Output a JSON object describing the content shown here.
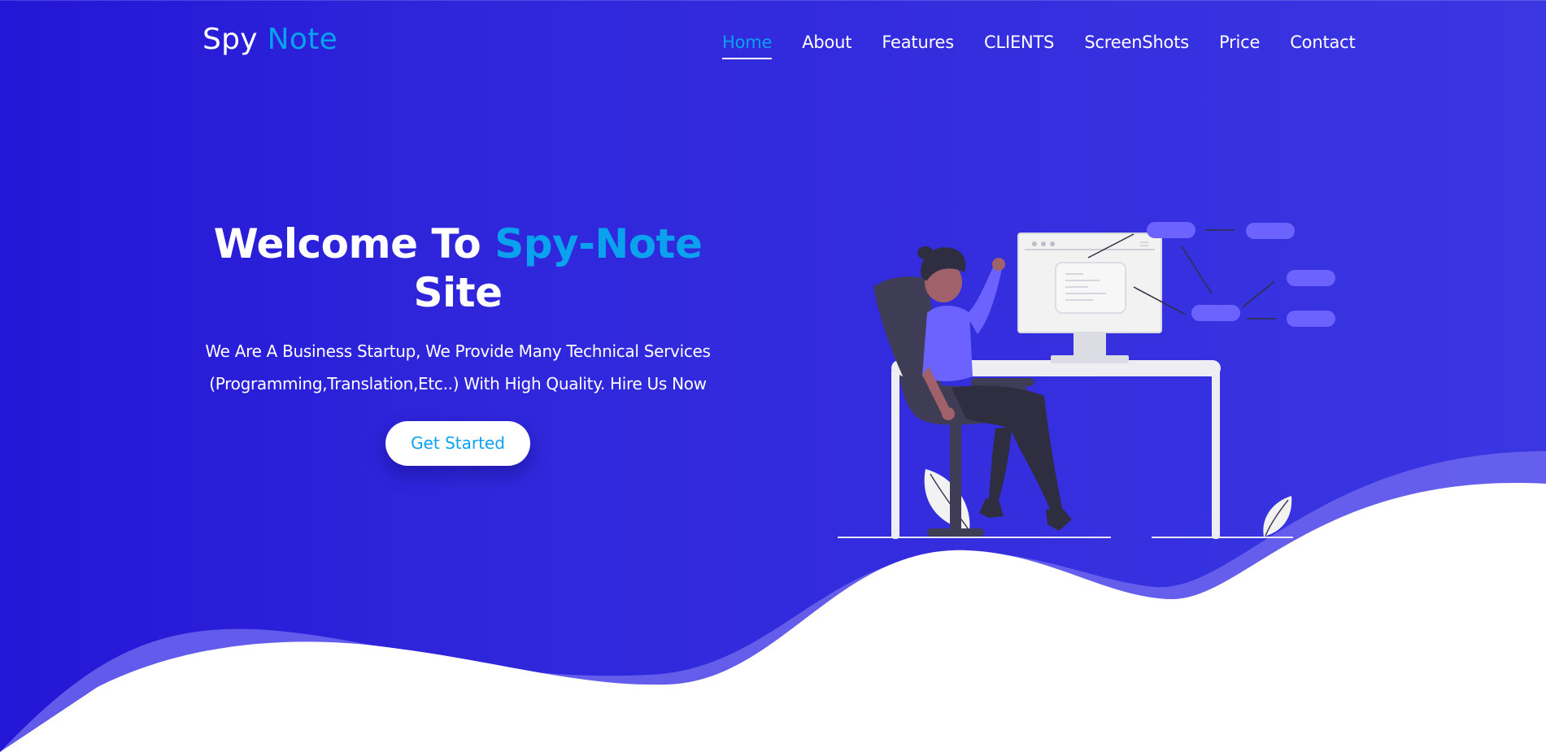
{
  "brand": {
    "part1": "Spy",
    "part2": "Note"
  },
  "nav": {
    "items": [
      {
        "label": "Home",
        "active": true
      },
      {
        "label": "About"
      },
      {
        "label": "Features"
      },
      {
        "label": "CLIENTS"
      },
      {
        "label": "ScreenShots"
      },
      {
        "label": "Price"
      },
      {
        "label": "Contact"
      }
    ]
  },
  "hero": {
    "title_prefix": "Welcome To",
    "title_accent": "Spy-Note",
    "title_suffix": "Site",
    "description": "We Are A Business Startup, We Provide Many Technical Services (Programming,Translation,Etc..) With High Quality. Hire Us Now",
    "cta_label": "Get Started"
  },
  "colors": {
    "accent": "#0aa1ef",
    "background": "#2f26db",
    "wave_light": "#6d66ee"
  }
}
